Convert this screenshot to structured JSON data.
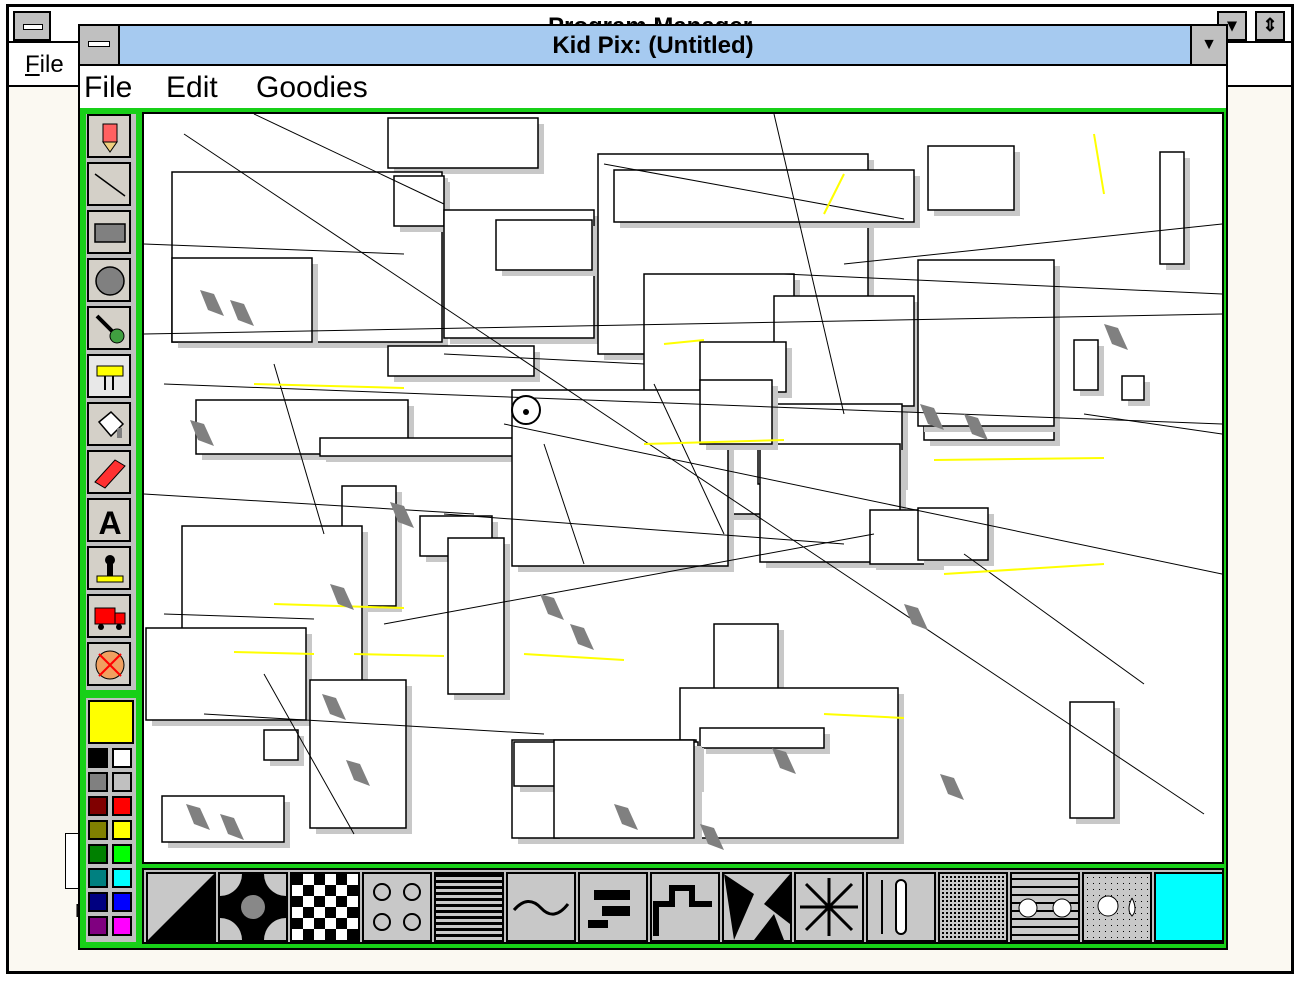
{
  "program_manager": {
    "title": "Program Manager",
    "menu_file": "File",
    "icon_label": "M"
  },
  "kidpix": {
    "title": "Kid Pix: (Untitled)",
    "menus": [
      "File",
      "Edit",
      "Goodies"
    ],
    "max_button": "▼",
    "tools": [
      {
        "name": "pencil-tool",
        "icon": "pencil-icon"
      },
      {
        "name": "line-tool",
        "icon": "line-icon"
      },
      {
        "name": "rectangle-tool",
        "icon": "rectangle-icon"
      },
      {
        "name": "oval-tool",
        "icon": "oval-icon"
      },
      {
        "name": "wacky-brush-tool",
        "icon": "brush-icon"
      },
      {
        "name": "electric-mixer-tool",
        "icon": "mixer-icon",
        "selected": true
      },
      {
        "name": "paint-can-tool",
        "icon": "paint-can-icon"
      },
      {
        "name": "eraser-tool",
        "icon": "eraser-icon"
      },
      {
        "name": "text-tool",
        "icon": "letter-a-icon",
        "label": "A"
      },
      {
        "name": "stamp-tool",
        "icon": "stamp-icon"
      },
      {
        "name": "moving-van-tool",
        "icon": "truck-icon"
      },
      {
        "name": "undo-guy-tool",
        "icon": "undo-face-icon"
      }
    ],
    "current_color": "#ffff00",
    "palette": [
      [
        "#000000",
        "#ffffff"
      ],
      [
        "#808080",
        "#c0c0c0"
      ],
      [
        "#800000",
        "#ff0000"
      ],
      [
        "#808000",
        "#ffff00"
      ],
      [
        "#008000",
        "#00ff00"
      ],
      [
        "#008080",
        "#00ffff"
      ],
      [
        "#000080",
        "#0000ff"
      ],
      [
        "#800080",
        "#ff00ff"
      ]
    ],
    "mixer_options": [
      "diagonal-split-option",
      "circles-option",
      "checkerboard-option",
      "flowers-option",
      "stripes-option",
      "wave-option",
      "blocks-option",
      "stairs-option",
      "shatter-option",
      "explode-option",
      "thin-line-option",
      "dots-option",
      "faces-option",
      "snowflake-option",
      "invert-color-option"
    ],
    "last_option_color": "#00ffff",
    "accent_green": "#18d018",
    "title_blue": "#a6caf0"
  }
}
